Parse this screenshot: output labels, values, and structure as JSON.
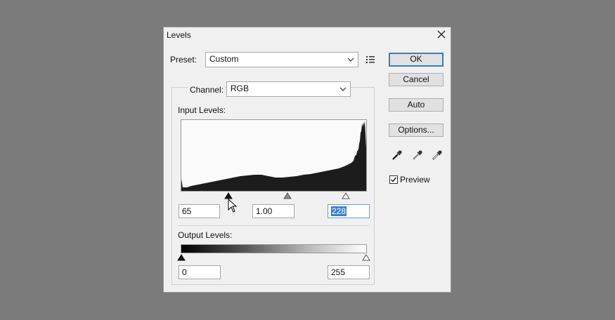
{
  "dialog": {
    "title": "Levels",
    "preset_label": "Preset:",
    "preset_value": "Custom",
    "channel_label": "Channel:",
    "channel_value": "RGB",
    "input_levels_label": "Input Levels:",
    "input_black": "65",
    "input_gamma": "1.00",
    "input_white": "228",
    "output_levels_label": "Output Levels:",
    "output_black": "0",
    "output_white": "255"
  },
  "buttons": {
    "ok": "OK",
    "cancel": "Cancel",
    "auto": "Auto",
    "options": "Options..."
  },
  "preview": {
    "label": "Preview",
    "checked": true
  },
  "icons": {
    "preset_menu": "preset-options-icon",
    "eyedroppers": [
      "black-point-eyedropper-icon",
      "gray-point-eyedropper-icon",
      "white-point-eyedropper-icon"
    ]
  }
}
